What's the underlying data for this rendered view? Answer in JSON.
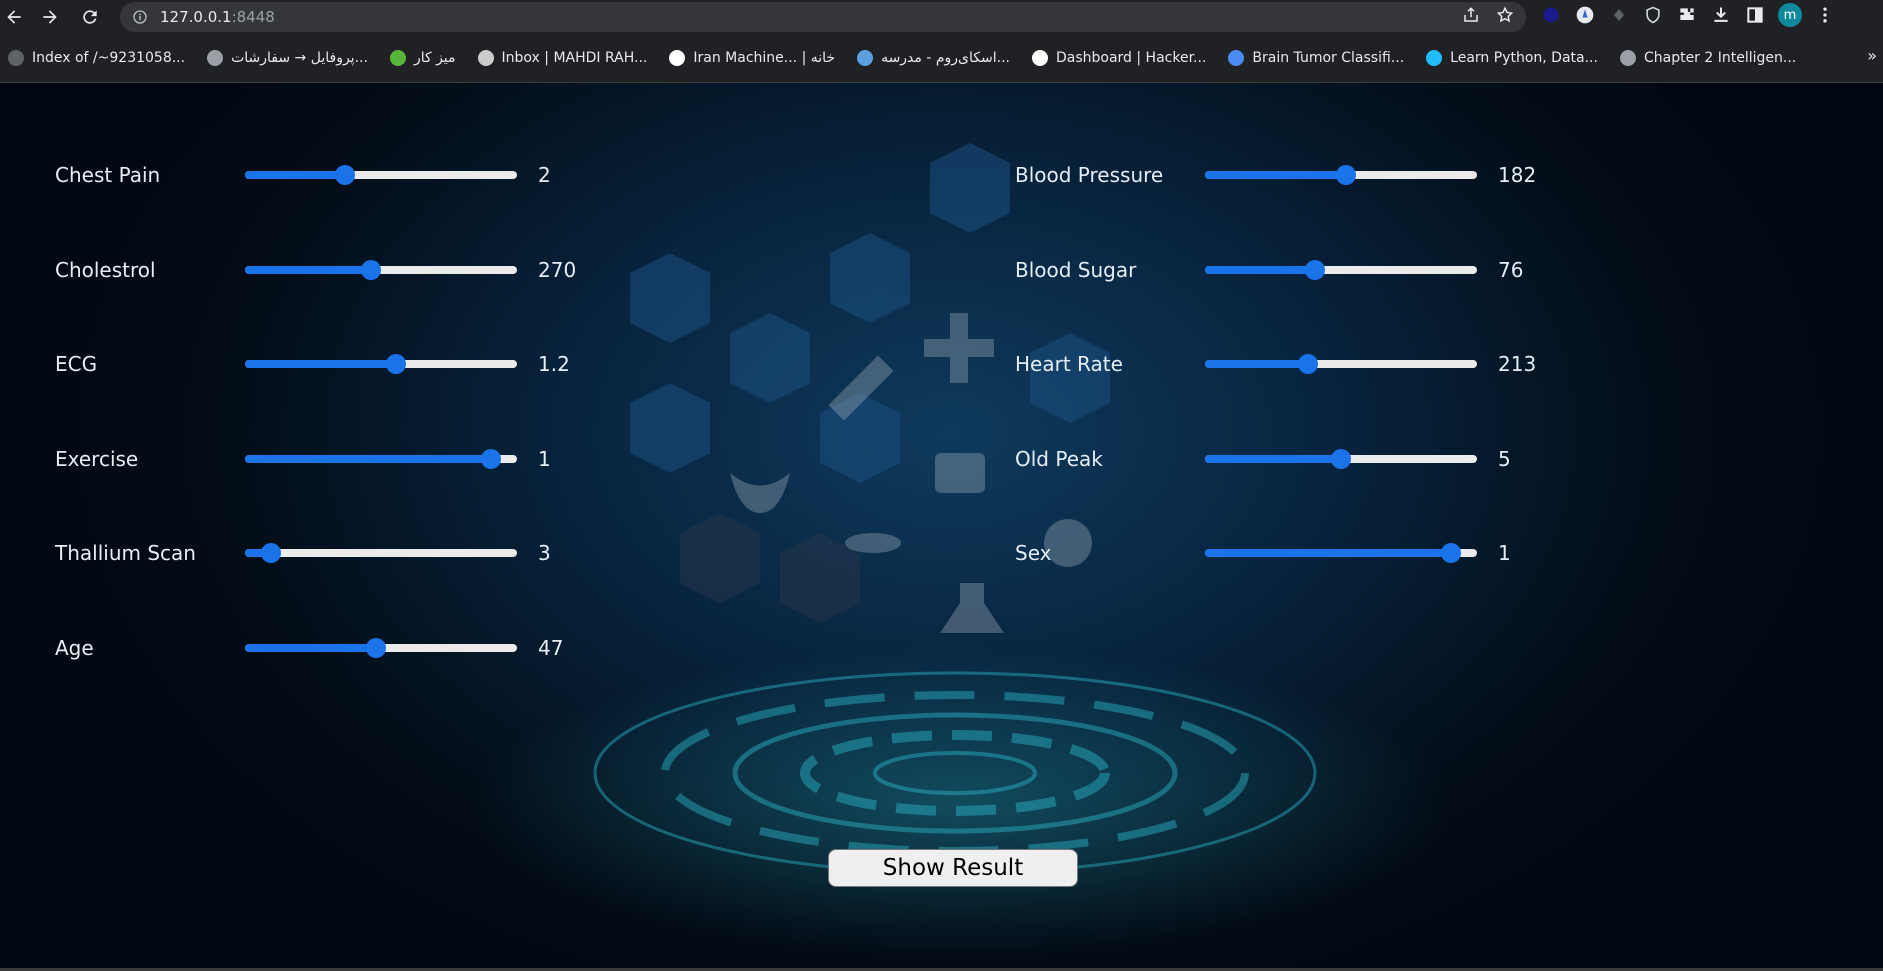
{
  "browser": {
    "url_host": "127.0.0.1",
    "url_port": ":8448",
    "profile_initial": "m",
    "bookmarks": [
      {
        "label": "Index of /~9231058...",
        "icon": "globe-icon",
        "color": "#5f6368"
      },
      {
        "label": "پروفایل → سفارشات...",
        "icon": "graduation-cap-icon",
        "color": "#9aa0a6"
      },
      {
        "label": "میز کار",
        "icon": "green-chat-icon",
        "color": "#57b73b"
      },
      {
        "label": "Inbox | MAHDI RAH...",
        "icon": "github-icon",
        "color": "#cccccc"
      },
      {
        "label": "Iran Machine... | خانه",
        "icon": "ml-icon",
        "color": "#ffffff"
      },
      {
        "label": "اسکای‌روم - مدرسه...",
        "icon": "bird-icon",
        "color": "#5aa0e0"
      },
      {
        "label": "Dashboard | Hacker...",
        "icon": "hackerrank-icon",
        "color": "#ffffff"
      },
      {
        "label": "Brain Tumor Classifi...",
        "icon": "layers-icon",
        "color": "#4c8bf5"
      },
      {
        "label": "Learn Python, Data...",
        "icon": "kaggle-icon",
        "color": "#20beff"
      },
      {
        "label": "Chapter 2 Intelligen...",
        "icon": "globe-icon",
        "color": "#9aa0a6"
      }
    ]
  },
  "left_params": [
    {
      "name": "chest-pain",
      "label": "Chest Pain",
      "value": "2",
      "level": 0.36
    },
    {
      "name": "cholestrol",
      "label": "Cholestrol",
      "value": "270",
      "level": 0.46
    },
    {
      "name": "ecg",
      "label": "ECG",
      "value": "1.2",
      "level": 0.56
    },
    {
      "name": "exercise",
      "label": "Exercise",
      "value": "1",
      "level": 0.93
    },
    {
      "name": "thallium-scan",
      "label": "Thallium Scan",
      "value": "3",
      "level": 0.07
    },
    {
      "name": "age",
      "label": "Age",
      "value": "47",
      "level": 0.48
    }
  ],
  "right_params": [
    {
      "name": "blood-pressure",
      "label": "Blood Pressure",
      "value": "182",
      "level": 0.52
    },
    {
      "name": "blood-sugar",
      "label": "Blood Sugar",
      "value": "76",
      "level": 0.4
    },
    {
      "name": "heart-rate",
      "label": "Heart Rate",
      "value": "213",
      "level": 0.37
    },
    {
      "name": "old-peak",
      "label": "Old Peak",
      "value": "5",
      "level": 0.5
    },
    {
      "name": "sex",
      "label": "Sex",
      "value": "1",
      "level": 0.93
    }
  ],
  "show_result_label": "Show Result",
  "colors": {
    "accent": "#1a73e8",
    "track": "#ebebeb"
  }
}
